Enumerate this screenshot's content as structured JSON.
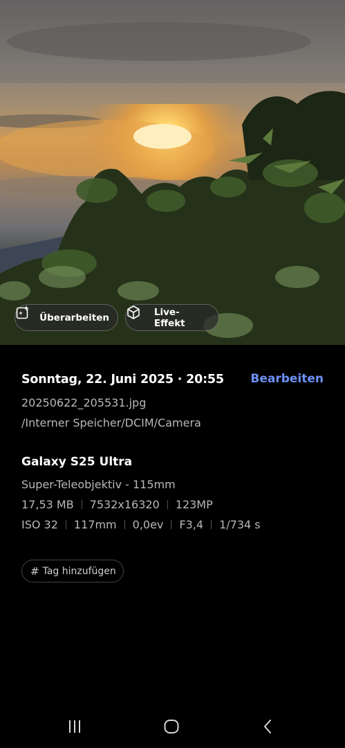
{
  "photo": {
    "actions": {
      "edit_label": "Überarbeiten",
      "live_effect_label": "Live-Effekt"
    }
  },
  "details": {
    "datetime": "Sonntag, 22. Juni 2025 · 20:55",
    "edit_link": "Bearbeiten",
    "filename": "20250622_205531.jpg",
    "path": "/Interner Speicher/DCIM/Camera",
    "device": "Galaxy S25 Ultra",
    "lens": "Super-Teleobjektiv - 115mm",
    "file_specs": [
      "17,53 MB",
      "7532x16320",
      "123MP"
    ],
    "exposure_specs": [
      "ISO 32",
      "117mm",
      "0,0ev",
      "F3,4",
      "1/734 s"
    ],
    "add_tag_label": "Tag hinzufügen"
  },
  "colors": {
    "accent": "#6e8ff7",
    "background": "#000000",
    "secondary_text": "#b8b8b8"
  },
  "icons": {
    "edit": "sparkle-edit-icon",
    "live_effect": "live-effect-cube-icon",
    "tag": "hash-icon",
    "nav_recents": "recents-icon",
    "nav_home": "home-icon",
    "nav_back": "back-icon"
  }
}
